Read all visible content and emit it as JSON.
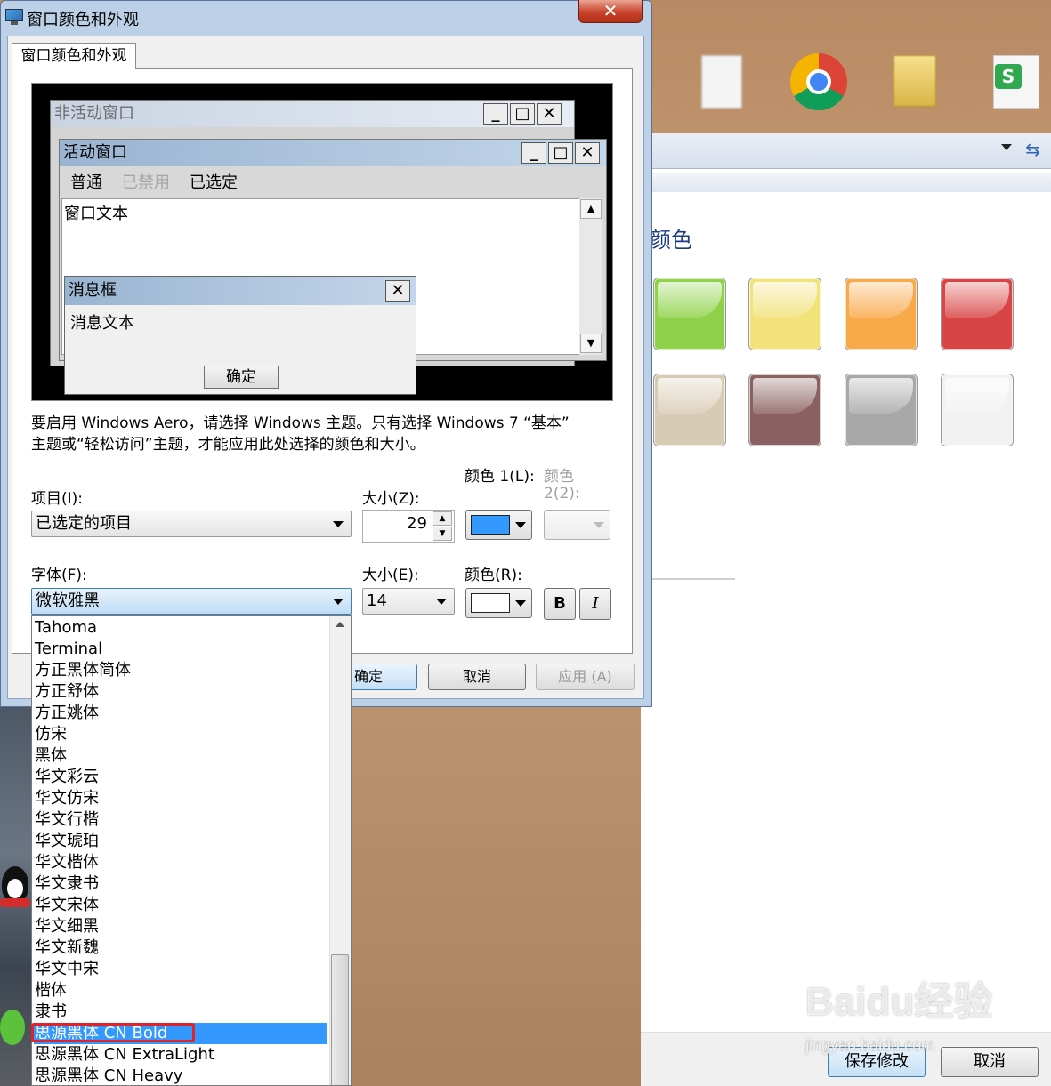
{
  "dialog": {
    "title": "窗口颜色和外观",
    "close_label": "✕",
    "tab_label": "窗口颜色和外观",
    "preview": {
      "inactive_title": "非活动窗口",
      "active_title": "活动窗口",
      "menu_items": [
        "普通",
        "已禁用",
        "已选定"
      ],
      "window_text": "窗口文本",
      "msgbox_title": "消息框",
      "msgbox_text": "消息文本",
      "msgbox_ok": "确定",
      "minimize": "_",
      "maximize": "□",
      "close": "✕"
    },
    "info_text_line1": "要启用 Windows Aero，请选择 Windows 主题。只有选择 Windows 7 “基本”",
    "info_text_line2": "主题或“轻松访问”主题，才能应用此处选择的颜色和大小。",
    "item_label": "项目(I):",
    "item_value": "已选定的项目",
    "size_label": "大小(Z):",
    "size_value": "29",
    "color1_label": "颜色 1(L):",
    "color1_value": "#3399ff",
    "color2_label_line1": "颜色",
    "color2_label_line2": "2(2):",
    "font_label": "字体(F):",
    "font_value": "微软雅黑",
    "font_size_label": "大小(E):",
    "font_size_value": "14",
    "font_color_label": "颜色(R):",
    "font_color_value": "#ffffff",
    "bold_label": "B",
    "italic_label": "I",
    "ok_button": "确定",
    "cancel_button": "取消",
    "apply_button": "应用 (A)"
  },
  "font_list": {
    "items": [
      "Tahoma",
      "Terminal",
      "方正黑体简体",
      "方正舒体",
      "方正姚体",
      "仿宋",
      "黑体",
      "华文彩云",
      "华文仿宋",
      "华文行楷",
      "华文琥珀",
      "华文楷体",
      "华文隶书",
      "华文宋体",
      "华文细黑",
      "华文新魏",
      "华文中宋",
      "楷体",
      "隶书",
      "思源黑体 CN Bold",
      "思源黑体 CN ExtraLight",
      "思源黑体 CN Heavy"
    ],
    "highlighted_index": 19,
    "highlight_color": "#3399ff",
    "annotation_color": "#e0222a"
  },
  "background_window": {
    "heading_fragment": "颜色",
    "swatch_colors": [
      "#8fd24a",
      "#f2e27a",
      "#f8a94a",
      "#d94545",
      "#d8cbb4",
      "#8a6060",
      "#a8a8a8",
      "#f2f2f2"
    ],
    "save_button": "保存修改",
    "cancel_button": "取消"
  },
  "watermark": {
    "brand": "Baidu经验",
    "url": "jingyan.baidu.com"
  }
}
